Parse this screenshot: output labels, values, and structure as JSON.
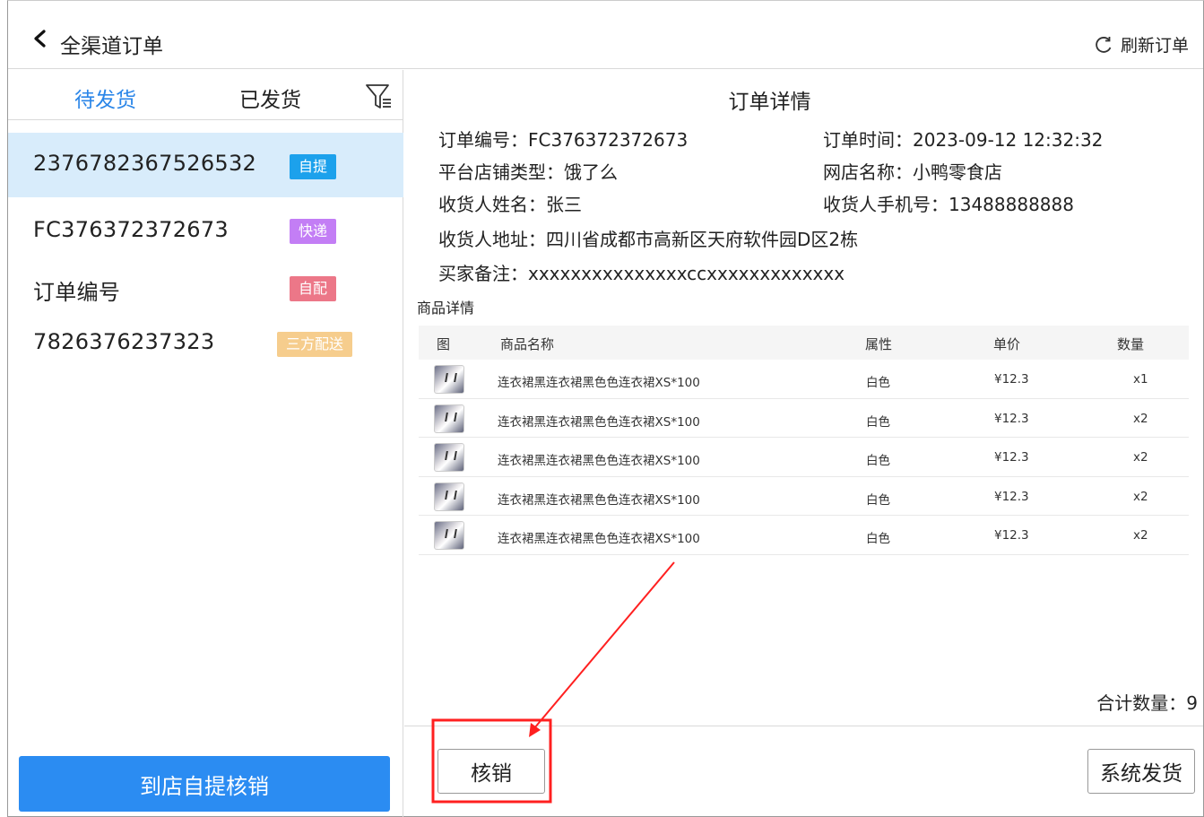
{
  "header": {
    "title": "全渠道订单",
    "refresh_label": "刷新订单"
  },
  "tabs": {
    "pending": "待发货",
    "shipped": "已发货"
  },
  "orders": [
    {
      "number": "2376782367526532",
      "tag": "自提",
      "tag_color": "#1ca1ec",
      "selected": true
    },
    {
      "number": "FC376372372673",
      "tag": "快递",
      "tag_color": "#c37ef5",
      "selected": false
    },
    {
      "number": "订单编号",
      "tag": "自配",
      "tag_color": "#ec7788",
      "selected": false
    },
    {
      "number": "7826376237323",
      "tag": "三方配送",
      "tag_color": "#f6cd8d",
      "selected": false
    }
  ],
  "left_action": "到店自提核销",
  "detail": {
    "title": "订单详情",
    "order_no": "订单编号：FC376372372673",
    "order_time": "订单时间：2023-09-12  12:32:32",
    "platform": "平台店铺类型：饿了么",
    "shop_name": "网店名称：小鸭零食店",
    "receiver_name": "收货人姓名：张三",
    "receiver_phone": "收货人手机号：13488888888",
    "receiver_address": "收货人地址：四川省成都市高新区天府软件园D区2栋",
    "buyer_note": "买家备注：xxxxxxxxxxxxxxxccxxxxxxxxxxxxx"
  },
  "goods": {
    "section_title": "商品详情",
    "headers": {
      "image": "图",
      "name": "商品名称",
      "attr": "属性",
      "price": "单价",
      "qty": "数量"
    },
    "rows": [
      {
        "name": "连衣裙黑连衣裙黑色色连衣裙XS*100",
        "attr": "白色",
        "price": "¥12.3",
        "qty": "x1"
      },
      {
        "name": "连衣裙黑连衣裙黑色色连衣裙XS*100",
        "attr": "白色",
        "price": "¥12.3",
        "qty": "x2"
      },
      {
        "name": "连衣裙黑连衣裙黑色色连衣裙XS*100",
        "attr": "白色",
        "price": "¥12.3",
        "qty": "x2"
      },
      {
        "name": "连衣裙黑连衣裙黑色色连衣裙XS*100",
        "attr": "白色",
        "price": "¥12.3",
        "qty": "x2"
      },
      {
        "name": "连衣裙黑连衣裙黑色色连衣裙XS*100",
        "attr": "白色",
        "price": "¥12.3",
        "qty": "x2"
      }
    ]
  },
  "total": "合计数量：9",
  "actions": {
    "verify": "核销",
    "ship": "系统发货"
  },
  "colors": {
    "accent": "#2b86e8",
    "selected_bg": "#d8ecfb",
    "annotation": "#ff2020"
  }
}
